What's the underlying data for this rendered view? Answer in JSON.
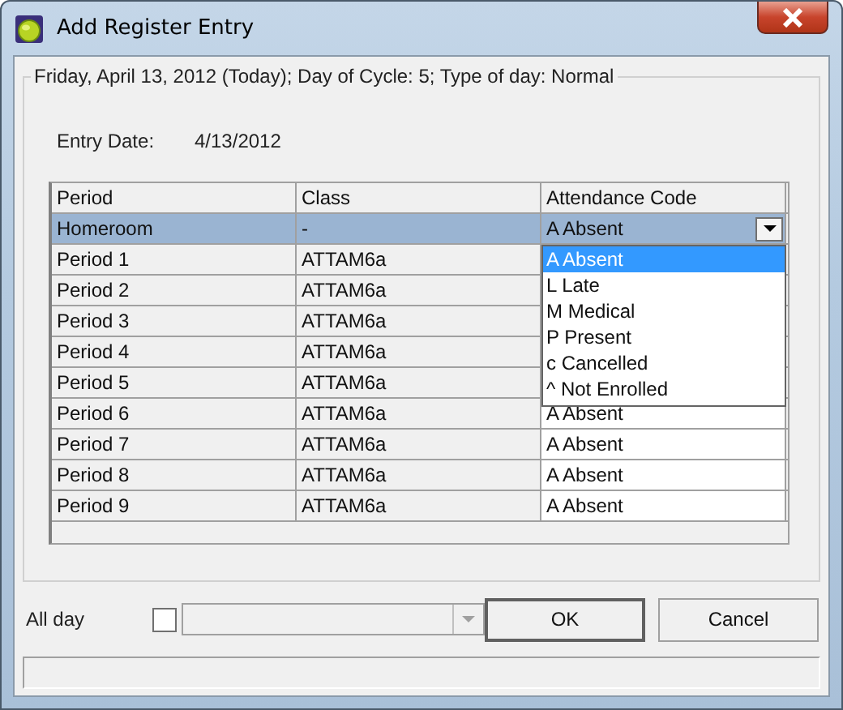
{
  "window": {
    "title": "Add Register Entry"
  },
  "group": {
    "legend": "Friday, April 13, 2012 (Today); Day of Cycle: 5; Type of day: Normal"
  },
  "entry_date": {
    "label": "Entry Date:",
    "value": "4/13/2012"
  },
  "table": {
    "columns": [
      "Period",
      "Class",
      "Attendance Code"
    ],
    "rows": [
      {
        "period": "Homeroom",
        "class": "-",
        "attendance": "A Absent",
        "selected": true,
        "open": true
      },
      {
        "period": "Period 1",
        "class": "ATTAM6a",
        "selected": false,
        "open": false
      },
      {
        "period": "Period 2",
        "class": "ATTAM6a",
        "selected": false,
        "open": false
      },
      {
        "period": "Period 3",
        "class": "ATTAM6a",
        "selected": false,
        "open": false
      },
      {
        "period": "Period 4",
        "class": "ATTAM6a",
        "selected": false,
        "open": false
      },
      {
        "period": "Period 5",
        "class": "ATTAM6a",
        "selected": false,
        "open": false
      },
      {
        "period": "Period 6",
        "class": "ATTAM6a",
        "attendance": "A Absent",
        "selected": false,
        "open": false
      },
      {
        "period": "Period 7",
        "class": "ATTAM6a",
        "attendance": "A Absent",
        "selected": false,
        "open": false
      },
      {
        "period": "Period 8",
        "class": "ATTAM6a",
        "attendance": "A Absent",
        "selected": false,
        "open": false
      },
      {
        "period": "Period 9",
        "class": "ATTAM6a",
        "attendance": "A Absent",
        "selected": false,
        "open": false
      }
    ]
  },
  "dropdown": {
    "options": [
      {
        "label": "A Absent",
        "selected": true
      },
      {
        "label": "L Late",
        "selected": false
      },
      {
        "label": "M Medical",
        "selected": false
      },
      {
        "label": "P Present",
        "selected": false
      },
      {
        "label": "c Cancelled",
        "selected": false
      },
      {
        "label": "^ Not Enrolled",
        "selected": false
      }
    ]
  },
  "all_day": {
    "label": "All day",
    "checked": false,
    "combo_disabled": true
  },
  "buttons": [
    {
      "label": "OK",
      "default": true
    },
    {
      "label": "Cancel",
      "default": false
    }
  ]
}
